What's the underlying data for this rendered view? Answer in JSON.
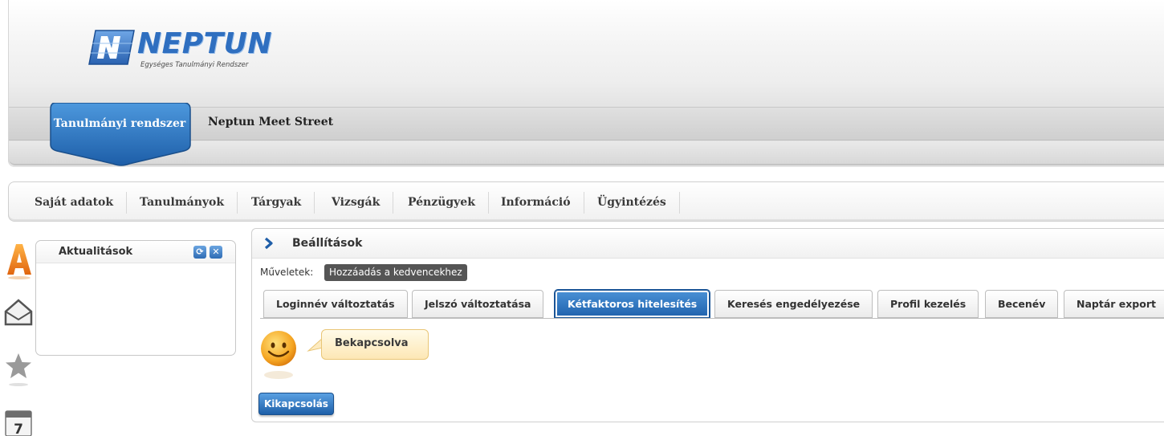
{
  "header": {
    "logo_text": "NEPTUN",
    "logo_tagline": "Egységes Tanulmányi Rendszer",
    "system_tabs": [
      {
        "label": "Tanulmányi rendszer",
        "active": true
      },
      {
        "label": "Neptun Meet Street",
        "active": false
      }
    ]
  },
  "main_menu": {
    "items": [
      "Saját adatok",
      "Tanulmányok",
      "Tárgyak",
      "Vizsgák",
      "Pénzügyek",
      "Információ",
      "Ügyintézés"
    ]
  },
  "left_rail": {
    "icons": [
      "news-a-icon",
      "envelope-icon",
      "star-icon",
      "calendar-icon"
    ],
    "calendar_day": "7"
  },
  "news_box": {
    "title": "Aktualitások"
  },
  "settings": {
    "title": "Beállítások",
    "operations_label": "Műveletek:",
    "add_favorite_label": "Hozzáadás a kedvencekhez",
    "tabs": [
      {
        "label": "Loginnév változtatás",
        "active": false
      },
      {
        "label": "Jelszó változtatása",
        "active": false
      },
      {
        "label": "Kétfaktoros hitelesítés",
        "active": true
      },
      {
        "label": "Keresés engedélyezése",
        "active": false
      },
      {
        "label": "Profil kezelés",
        "active": false
      },
      {
        "label": "Becenév",
        "active": false
      },
      {
        "label": "Naptár export",
        "active": false
      }
    ],
    "status_text": "Bekapcsolva",
    "disable_button_label": "Kikapcsolás"
  },
  "colors": {
    "brand_blue": "#2f6fc0",
    "active_tab_blue": "#1f62ad",
    "bubble_yellow": "#fde7b5",
    "news_orange": "#f07d1a"
  }
}
